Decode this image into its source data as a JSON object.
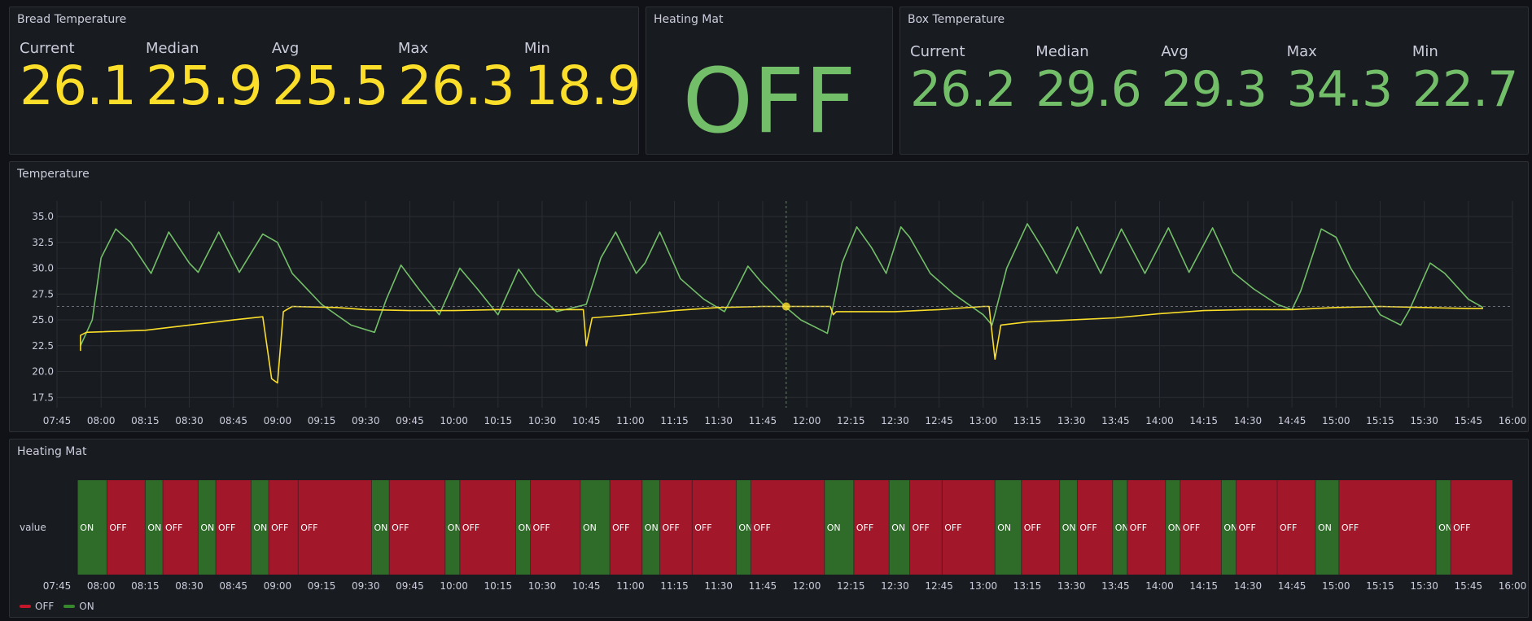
{
  "panels": {
    "bread": {
      "title": "Bread Temperature",
      "stats": [
        {
          "label": "Current",
          "value": "26.1"
        },
        {
          "label": "Median",
          "value": "25.9"
        },
        {
          "label": "Avg",
          "value": "25.5"
        },
        {
          "label": "Max",
          "value": "26.3"
        },
        {
          "label": "Min",
          "value": "18.9"
        }
      ]
    },
    "heating_mat_state": {
      "title": "Heating Mat",
      "value": "OFF"
    },
    "box": {
      "title": "Box Temperature",
      "stats": [
        {
          "label": "Current",
          "value": "26.2"
        },
        {
          "label": "Median",
          "value": "29.6"
        },
        {
          "label": "Avg",
          "value": "29.3"
        },
        {
          "label": "Max",
          "value": "34.3"
        },
        {
          "label": "Min",
          "value": "22.7"
        }
      ]
    },
    "temperature": {
      "title": "Temperature"
    },
    "heating_mat_timeline": {
      "title": "Heating Mat",
      "row_label": "value",
      "legend": [
        {
          "label": "OFF",
          "color": "#c4162a"
        },
        {
          "label": "ON",
          "color": "#37872d"
        }
      ]
    }
  },
  "colors": {
    "yellow": "#fade2a",
    "green": "#73bf69",
    "off": "#a3172a",
    "on": "#2f6b29"
  },
  "chart_data": [
    {
      "type": "line",
      "title": "Temperature",
      "x_ticks": [
        "07:45",
        "08:00",
        "08:15",
        "08:30",
        "08:45",
        "09:00",
        "09:15",
        "09:30",
        "09:45",
        "10:00",
        "10:15",
        "10:30",
        "10:45",
        "11:00",
        "11:15",
        "11:30",
        "11:45",
        "12:00",
        "12:15",
        "12:30",
        "12:45",
        "13:00",
        "13:15",
        "13:30",
        "13:45",
        "14:00",
        "14:15",
        "14:30",
        "14:45",
        "15:00",
        "15:15",
        "15:30",
        "15:45",
        "16:00"
      ],
      "y_ticks": [
        "17.5",
        "20.0",
        "22.5",
        "25.0",
        "27.5",
        "30.0",
        "32.5",
        "35.0"
      ],
      "ylim": [
        16.5,
        36.5
      ],
      "xlim": [
        "07:45",
        "16:00"
      ],
      "grid": true,
      "crosshair_time": "11:53",
      "series": [
        {
          "name": "Box Temperature",
          "color": "#73bf69",
          "points": [
            [
              "07:53",
              22.5
            ],
            [
              "07:57",
              25
            ],
            [
              "08:00",
              31
            ],
            [
              "08:05",
              33.8
            ],
            [
              "08:10",
              32.5
            ],
            [
              "08:17",
              29.5
            ],
            [
              "08:23",
              33.5
            ],
            [
              "08:30",
              30.5
            ],
            [
              "08:33",
              29.6
            ],
            [
              "08:40",
              33.5
            ],
            [
              "08:47",
              29.6
            ],
            [
              "08:55",
              33.3
            ],
            [
              "09:00",
              32.5
            ],
            [
              "09:05",
              29.5
            ],
            [
              "09:15",
              26.5
            ],
            [
              "09:25",
              24.5
            ],
            [
              "09:33",
              23.8
            ],
            [
              "09:37",
              27
            ],
            [
              "09:42",
              30.3
            ],
            [
              "09:48",
              28
            ],
            [
              "09:55",
              25.5
            ],
            [
              "10:02",
              30
            ],
            [
              "10:08",
              28
            ],
            [
              "10:15",
              25.5
            ],
            [
              "10:22",
              29.9
            ],
            [
              "10:28",
              27.5
            ],
            [
              "10:35",
              25.8
            ],
            [
              "10:45",
              26.5
            ],
            [
              "10:50",
              31
            ],
            [
              "10:55",
              33.5
            ],
            [
              "11:02",
              29.5
            ],
            [
              "11:05",
              30.5
            ],
            [
              "11:10",
              33.5
            ],
            [
              "11:17",
              29
            ],
            [
              "11:25",
              27
            ],
            [
              "11:32",
              25.8
            ],
            [
              "11:37",
              28.5
            ],
            [
              "11:40",
              30.2
            ],
            [
              "11:45",
              28.5
            ],
            [
              "11:53",
              26.2
            ],
            [
              "11:58",
              25
            ],
            [
              "12:05",
              24
            ],
            [
              "12:07",
              23.7
            ],
            [
              "12:12",
              30.5
            ],
            [
              "12:17",
              34
            ],
            [
              "12:22",
              32
            ],
            [
              "12:27",
              29.5
            ],
            [
              "12:32",
              34
            ],
            [
              "12:35",
              33
            ],
            [
              "12:42",
              29.5
            ],
            [
              "12:50",
              27.5
            ],
            [
              "13:00",
              25.5
            ],
            [
              "13:03",
              24.5
            ],
            [
              "13:08",
              30
            ],
            [
              "13:15",
              34.3
            ],
            [
              "13:20",
              32
            ],
            [
              "13:25",
              29.5
            ],
            [
              "13:32",
              34
            ],
            [
              "13:40",
              29.5
            ],
            [
              "13:47",
              33.8
            ],
            [
              "13:55",
              29.5
            ],
            [
              "14:03",
              33.9
            ],
            [
              "14:10",
              29.6
            ],
            [
              "14:18",
              33.9
            ],
            [
              "14:25",
              29.6
            ],
            [
              "14:32",
              28
            ],
            [
              "14:40",
              26.5
            ],
            [
              "14:45",
              26
            ],
            [
              "14:48",
              27.8
            ],
            [
              "14:55",
              33.8
            ],
            [
              "15:00",
              33
            ],
            [
              "15:05",
              30
            ],
            [
              "15:15",
              25.5
            ],
            [
              "15:22",
              24.5
            ],
            [
              "15:25",
              26
            ],
            [
              "15:32",
              30.5
            ],
            [
              "15:37",
              29.5
            ],
            [
              "15:45",
              27
            ],
            [
              "15:50",
              26.2
            ]
          ]
        },
        {
          "name": "Bread Temperature",
          "color": "#fade2a",
          "points": [
            [
              "07:53",
              22
            ],
            [
              "07:53",
              23.5
            ],
            [
              "07:55",
              23.8
            ],
            [
              "08:15",
              24
            ],
            [
              "08:30",
              24.5
            ],
            [
              "08:45",
              25
            ],
            [
              "08:55",
              25.3
            ],
            [
              "08:58",
              19.3
            ],
            [
              "09:00",
              18.9
            ],
            [
              "09:02",
              25.8
            ],
            [
              "09:05",
              26.3
            ],
            [
              "09:20",
              26.2
            ],
            [
              "09:30",
              26
            ],
            [
              "09:45",
              25.9
            ],
            [
              "10:00",
              25.9
            ],
            [
              "10:15",
              26
            ],
            [
              "10:30",
              26
            ],
            [
              "10:44",
              26
            ],
            [
              "10:45",
              22.5
            ],
            [
              "10:47",
              25.2
            ],
            [
              "11:00",
              25.5
            ],
            [
              "11:15",
              25.9
            ],
            [
              "11:30",
              26.2
            ],
            [
              "11:45",
              26.3
            ],
            [
              "12:00",
              26.3
            ],
            [
              "12:08",
              26.3
            ],
            [
              "12:09",
              25.5
            ],
            [
              "12:10",
              25.8
            ],
            [
              "12:30",
              25.8
            ],
            [
              "12:45",
              26
            ],
            [
              "13:00",
              26.3
            ],
            [
              "13:02",
              26.3
            ],
            [
              "13:04",
              21.2
            ],
            [
              "13:06",
              24.5
            ],
            [
              "13:15",
              24.8
            ],
            [
              "13:30",
              25
            ],
            [
              "13:45",
              25.2
            ],
            [
              "14:00",
              25.6
            ],
            [
              "14:15",
              25.9
            ],
            [
              "14:30",
              26
            ],
            [
              "14:45",
              26
            ],
            [
              "15:00",
              26.2
            ],
            [
              "15:15",
              26.3
            ],
            [
              "15:30",
              26.2
            ],
            [
              "15:45",
              26.1
            ],
            [
              "15:50",
              26.1
            ]
          ]
        }
      ]
    },
    {
      "type": "state-timeline",
      "title": "Heating Mat",
      "x_ticks": [
        "07:45",
        "08:00",
        "08:15",
        "08:30",
        "08:45",
        "09:00",
        "09:15",
        "09:30",
        "09:45",
        "10:00",
        "10:15",
        "10:30",
        "10:45",
        "11:00",
        "11:15",
        "11:30",
        "11:45",
        "12:00",
        "12:15",
        "12:30",
        "12:45",
        "13:00",
        "13:15",
        "13:30",
        "13:45",
        "14:00",
        "14:15",
        "14:30",
        "14:45",
        "15:00",
        "15:15",
        "15:30",
        "15:45",
        "16:00"
      ],
      "xlim": [
        "07:45",
        "16:00"
      ],
      "segments": [
        {
          "state": "ON",
          "start": "07:52",
          "end": "08:02"
        },
        {
          "state": "OFF",
          "start": "08:02",
          "end": "08:15",
          "label": "OFF"
        },
        {
          "state": "ON",
          "start": "08:15",
          "end": "08:21"
        },
        {
          "state": "OFF",
          "start": "08:21",
          "end": "08:33"
        },
        {
          "state": "ON",
          "start": "08:33",
          "end": "08:39"
        },
        {
          "state": "OFF",
          "start": "08:39",
          "end": "08:51"
        },
        {
          "state": "ON",
          "start": "08:51",
          "end": "08:57"
        },
        {
          "state": "OFF",
          "start": "08:57",
          "end": "09:07"
        },
        {
          "state": "OFF",
          "start": "09:07",
          "end": "09:32"
        },
        {
          "state": "ON",
          "start": "09:32",
          "end": "09:38"
        },
        {
          "state": "OFF",
          "start": "09:38",
          "end": "09:57"
        },
        {
          "state": "ON",
          "start": "09:57",
          "end": "10:02"
        },
        {
          "state": "OFF",
          "start": "10:02",
          "end": "10:21"
        },
        {
          "state": "ON",
          "start": "10:21",
          "end": "10:26"
        },
        {
          "state": "OFF",
          "start": "10:26",
          "end": "10:43"
        },
        {
          "state": "ON",
          "start": "10:43",
          "end": "10:53"
        },
        {
          "state": "OFF",
          "start": "10:53",
          "end": "11:04"
        },
        {
          "state": "ON",
          "start": "11:04",
          "end": "11:10"
        },
        {
          "state": "OFF",
          "start": "11:10",
          "end": "11:21"
        },
        {
          "state": "OFF",
          "start": "11:21",
          "end": "11:36"
        },
        {
          "state": "ON",
          "start": "11:36",
          "end": "11:41"
        },
        {
          "state": "OFF",
          "start": "11:41",
          "end": "12:06"
        },
        {
          "state": "ON",
          "start": "12:06",
          "end": "12:16"
        },
        {
          "state": "OFF",
          "start": "12:16",
          "end": "12:28"
        },
        {
          "state": "ON",
          "start": "12:28",
          "end": "12:35"
        },
        {
          "state": "OFF",
          "start": "12:35",
          "end": "12:46"
        },
        {
          "state": "OFF",
          "start": "12:46",
          "end": "13:04"
        },
        {
          "state": "ON",
          "start": "13:04",
          "end": "13:13"
        },
        {
          "state": "OFF",
          "start": "13:13",
          "end": "13:26"
        },
        {
          "state": "ON",
          "start": "13:26",
          "end": "13:32"
        },
        {
          "state": "OFF",
          "start": "13:32",
          "end": "13:44"
        },
        {
          "state": "ON",
          "start": "13:44",
          "end": "13:49"
        },
        {
          "state": "OFF",
          "start": "13:49",
          "end": "14:02"
        },
        {
          "state": "ON",
          "start": "14:02",
          "end": "14:07"
        },
        {
          "state": "OFF",
          "start": "14:07",
          "end": "14:21"
        },
        {
          "state": "ON",
          "start": "14:21",
          "end": "14:26"
        },
        {
          "state": "OFF",
          "start": "14:26",
          "end": "14:40"
        },
        {
          "state": "OFF",
          "start": "14:40",
          "end": "14:53"
        },
        {
          "state": "ON",
          "start": "14:53",
          "end": "15:01"
        },
        {
          "state": "OFF",
          "start": "15:01",
          "end": "15:34"
        },
        {
          "state": "ON",
          "start": "15:34",
          "end": "15:39"
        },
        {
          "state": "OFF",
          "start": "15:39",
          "end": "16:06"
        }
      ]
    }
  ]
}
